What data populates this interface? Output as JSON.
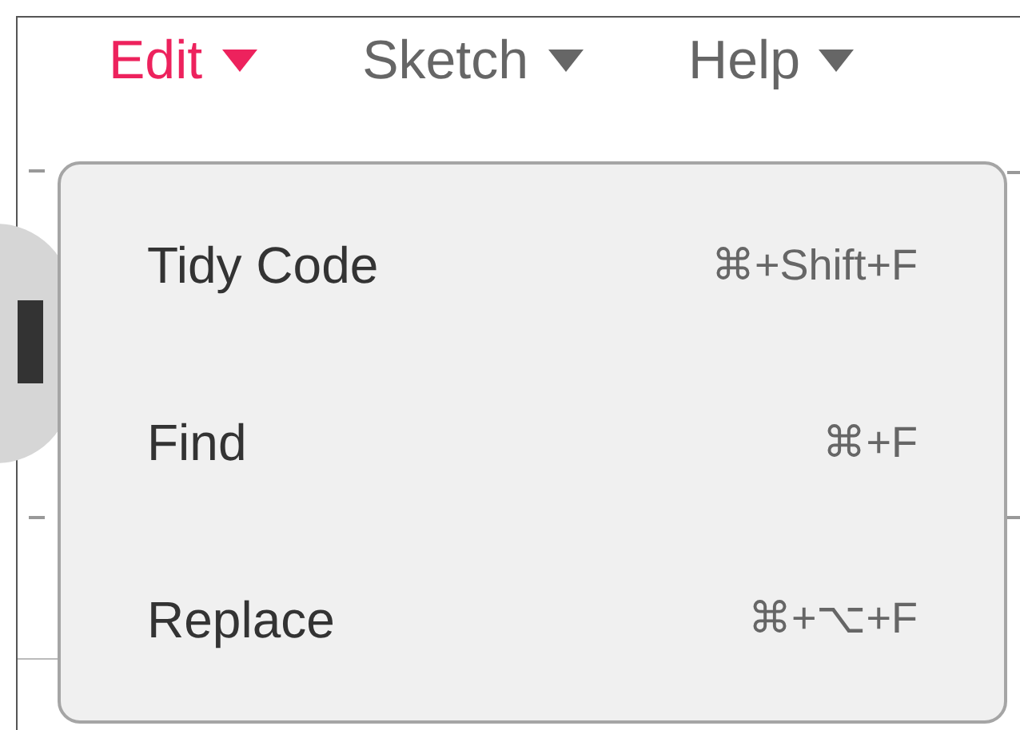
{
  "menu_bar": [
    {
      "label": "Edit",
      "selected": true
    },
    {
      "label": "Sketch",
      "selected": false
    },
    {
      "label": "Help",
      "selected": false
    }
  ],
  "dropdown": {
    "items": [
      {
        "label": "Tidy Code",
        "shortcut": "⌘+Shift+F"
      },
      {
        "label": "Find",
        "shortcut": "⌘+F"
      },
      {
        "label": "Replace",
        "shortcut": "⌘+⌥+F"
      }
    ]
  }
}
